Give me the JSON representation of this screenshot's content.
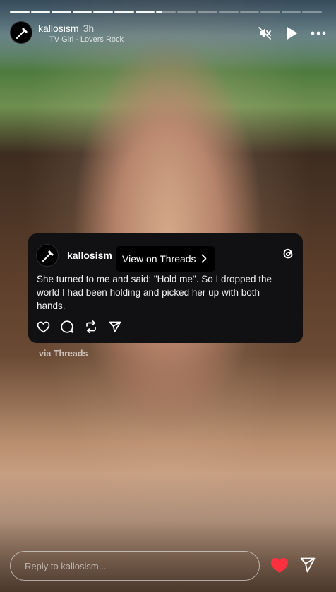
{
  "story": {
    "segments_total": 15,
    "segments_complete": 7,
    "current_segment_progress": 0.3
  },
  "header": {
    "username": "kallosism",
    "time": "3h",
    "music_artist": "TV Girl",
    "music_separator": "·",
    "music_song": "Lovers Rock"
  },
  "card": {
    "username": "kallosism",
    "tooltip": "View on Threads",
    "text": "She turned to me and said: \"Hold me\". So I dropped the world I had been holding and picked her up with both hands."
  },
  "via": "via Threads",
  "reply": {
    "placeholder": "Reply to kallosism..."
  },
  "colors": {
    "like": "#ff3040",
    "card_bg": "#111113"
  },
  "icons": [
    "mute-icon",
    "play-icon",
    "more-icon",
    "threads-icon",
    "heart-icon",
    "comment-icon",
    "repost-icon",
    "share-icon",
    "like-heart-icon",
    "send-icon",
    "chevron-right-icon"
  ]
}
